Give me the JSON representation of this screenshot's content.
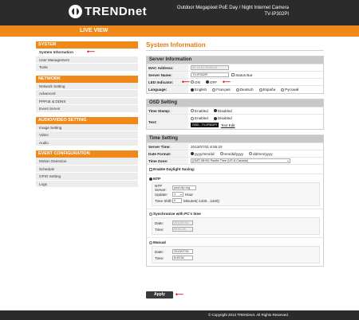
{
  "header": {
    "logo": "TRENDnet",
    "product_line1": "Outdoor Megapixel PoE Day / Night Internet Camera",
    "product_line2": "TV-IP302PI"
  },
  "nav": {
    "live_view": "LIVE VIEW"
  },
  "sidebar": {
    "system": {
      "title": "SYSTEM",
      "items": [
        "System Information",
        "User Management",
        "Tools"
      ]
    },
    "network": {
      "title": "NETWORK",
      "items": [
        "Network Setting",
        "Advanced",
        "PPPoE & DDNS",
        "Event Server"
      ]
    },
    "av": {
      "title": "AUDIO/VIDEO SETTING",
      "items": [
        "Image Setting",
        "Video",
        "Audio"
      ]
    },
    "event": {
      "title": "EVENT CONFIGURATION",
      "items": [
        "Motion Detection",
        "Schedule",
        "GPIO Setting",
        "Logs"
      ]
    }
  },
  "page": {
    "title": "System Information"
  },
  "server_info": {
    "title": "Server Information",
    "mac_label": "MAC Address:",
    "mac_value": "00:14:D1:90:80:20",
    "name_label": "Server Name:",
    "name_value": "TV-IP302PI",
    "status_bar_label": "Status Bar",
    "led_label": "LED Indicator:",
    "led_on": "ON",
    "led_off": "OFF",
    "lang_label": "Language:",
    "languages": [
      "English",
      "Français",
      "Deutsch",
      "España",
      "Русский"
    ]
  },
  "osd": {
    "title": "OSD Setting",
    "timestamp_label": "Time Stamp:",
    "text_label": "Text:",
    "enabled": "Enabled",
    "disabled": "Disabled",
    "text_value": "OSD - TV-IP302PI",
    "text_edit": "Text Edit"
  },
  "time": {
    "title": "Time Setting",
    "server_time_label": "Server Time:",
    "server_time_value": "2013/07/31  8:55:23",
    "date_format_label": "Date Format:",
    "date_formats": [
      "yyyy/mm/dd",
      "mm/dd/yyyy",
      "dd/mm/yyyy"
    ],
    "timezone_label": "Time Zone:",
    "timezone_value": "(GMT-08:00) Pacific Time (US & Canada)",
    "dst_label": "Enable Daylight Saving:",
    "ntp_label": "NTP",
    "ntp_server_label": "NTP Server:",
    "ntp_server_value": "pool.ntp.org",
    "update_label": "Update:",
    "update_value": "1",
    "update_unit": "Hour",
    "shift_label": "Time Shift:",
    "shift_value": "0",
    "shift_unit": "Minutes(-1440...1440)",
    "sync_pc_label": "Synchronize with PC's time",
    "pc_date_label": "Date:",
    "pc_date_value": "2013/07/31",
    "pc_time_label": "Time:",
    "pc_time_value": "09:51:26",
    "manual_label": "Manual",
    "manual_date_label": "Date:",
    "manual_date_value": "2013/07/31",
    "manual_time_label": "Time:",
    "manual_time_value": "8:49:54"
  },
  "apply_label": "Apply",
  "footer": {
    "copyright": "© Copyright 2013 TRENDnet. All Rights Reserved."
  },
  "colors": {
    "accent": "#ef8a1a",
    "header_bg": "#2b2b2b",
    "annotation_arrow": "#d10000"
  }
}
